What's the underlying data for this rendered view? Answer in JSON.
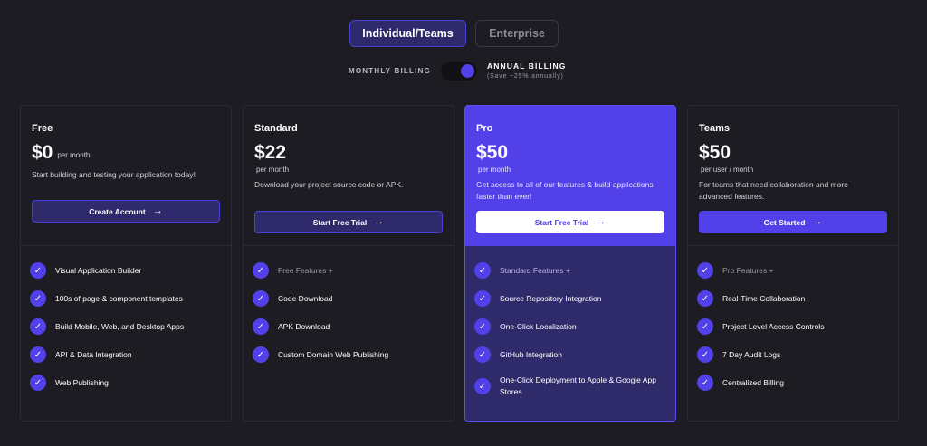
{
  "tabs": [
    {
      "label": "Individual/Teams",
      "active": true
    },
    {
      "label": "Enterprise",
      "active": false
    }
  ],
  "billing": {
    "monthly_label": "MONTHLY BILLING",
    "annual_label": "ANNUAL BILLING",
    "annual_note": "(Save ~25% annually)",
    "annual_selected": true
  },
  "plans": [
    {
      "name": "Free",
      "price": "$0",
      "per": "per month",
      "description": "Start building and testing your application today!",
      "cta": "Create Account",
      "features": [
        "Visual Application Builder",
        "100s of page & component templates",
        "Build Mobile, Web, and Desktop Apps",
        "API & Data Integration",
        "Web Publishing"
      ]
    },
    {
      "name": "Standard",
      "price": "$22",
      "per": "per month",
      "description": "Download your project source code or APK.",
      "cta": "Start Free Trial",
      "features": [
        "Free Features +",
        "Code Download",
        "APK Download",
        "Custom Domain Web Publishing"
      ]
    },
    {
      "name": "Pro",
      "price": "$50",
      "per": "per month",
      "description": "Get access to all of our features & build applications faster than ever!",
      "cta": "Start Free Trial",
      "features": [
        "Standard Features +",
        "Source Repository Integration",
        "One-Click Localization",
        "GitHub Integration",
        "One-Click Deployment to Apple & Google App Stores"
      ]
    },
    {
      "name": "Teams",
      "price": "$50",
      "per": "per user / month",
      "description": "For teams that need collaboration and more advanced features.",
      "cta": "Get Started",
      "features": [
        "Pro Features +",
        "Real-Time Collaboration",
        "Project Level Access Controls",
        "7 Day Audit Logs",
        "Centralized Billing"
      ]
    }
  ],
  "icons": {
    "check": "check-icon",
    "arrow": "arrow-right-icon"
  },
  "colors": {
    "accent": "#5240e9",
    "background": "#1c1c22",
    "pro_card": "#2f2b6b"
  }
}
